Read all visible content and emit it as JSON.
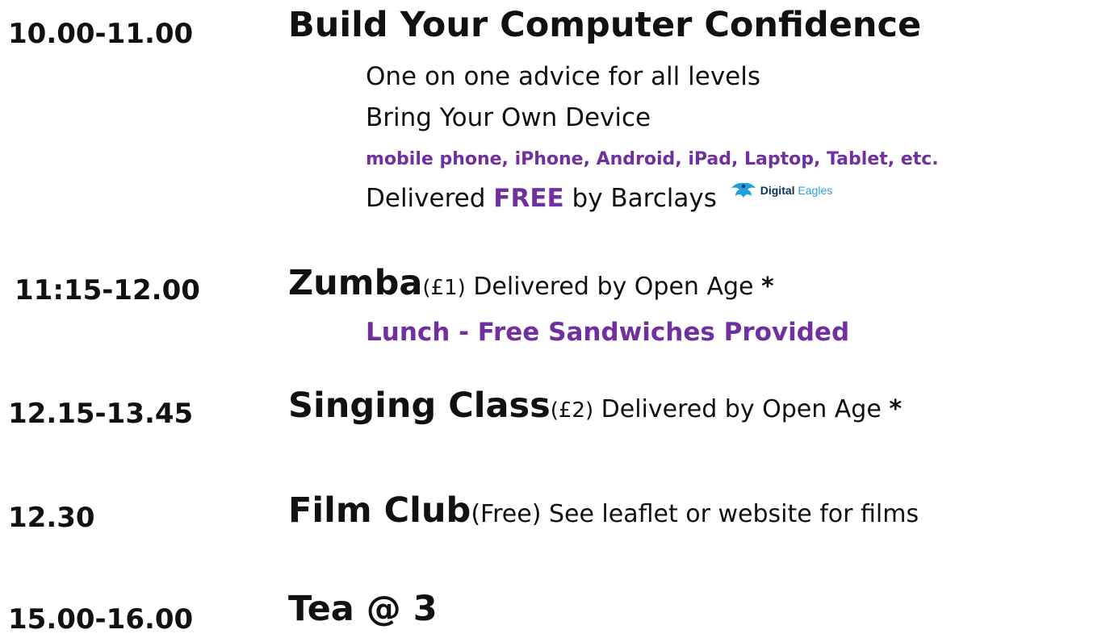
{
  "colors": {
    "accent": "#7030a0",
    "text": "#111111",
    "eagle_blue": "#1f9fe0"
  },
  "items": [
    {
      "time": "10.00-11.00",
      "name": "Build Your Computer Confidence",
      "details": [
        "One on one advice for all levels",
        "Bring Your Own Device",
        "mobile phone, iPhone, Android, iPad, Laptop, Tablet, etc."
      ],
      "delivered_prefix": "Delivered ",
      "delivered_free": "FREE",
      "delivered_suffix": " by Barclays",
      "logo": {
        "icon": "eagle-icon",
        "word1": "Digital",
        "word2": "Eagles"
      }
    },
    {
      "time": "11:15-12.00",
      "name": "Zumba",
      "price": "(£1)",
      "rest": " Delivered by Open Age ",
      "star": "*",
      "note": "Lunch - Free Sandwiches Provided"
    },
    {
      "time": "12.15-13.45",
      "name": "Singing Class",
      "price": "(£2)",
      "rest": " Delivered by Open Age ",
      "star": "*"
    },
    {
      "time": "12.30",
      "name": "Film Club",
      "price": "(Free)",
      "rest": " See leaflet or website for films"
    },
    {
      "time": "15.00-16.00",
      "name": "Tea @ 3"
    }
  ]
}
